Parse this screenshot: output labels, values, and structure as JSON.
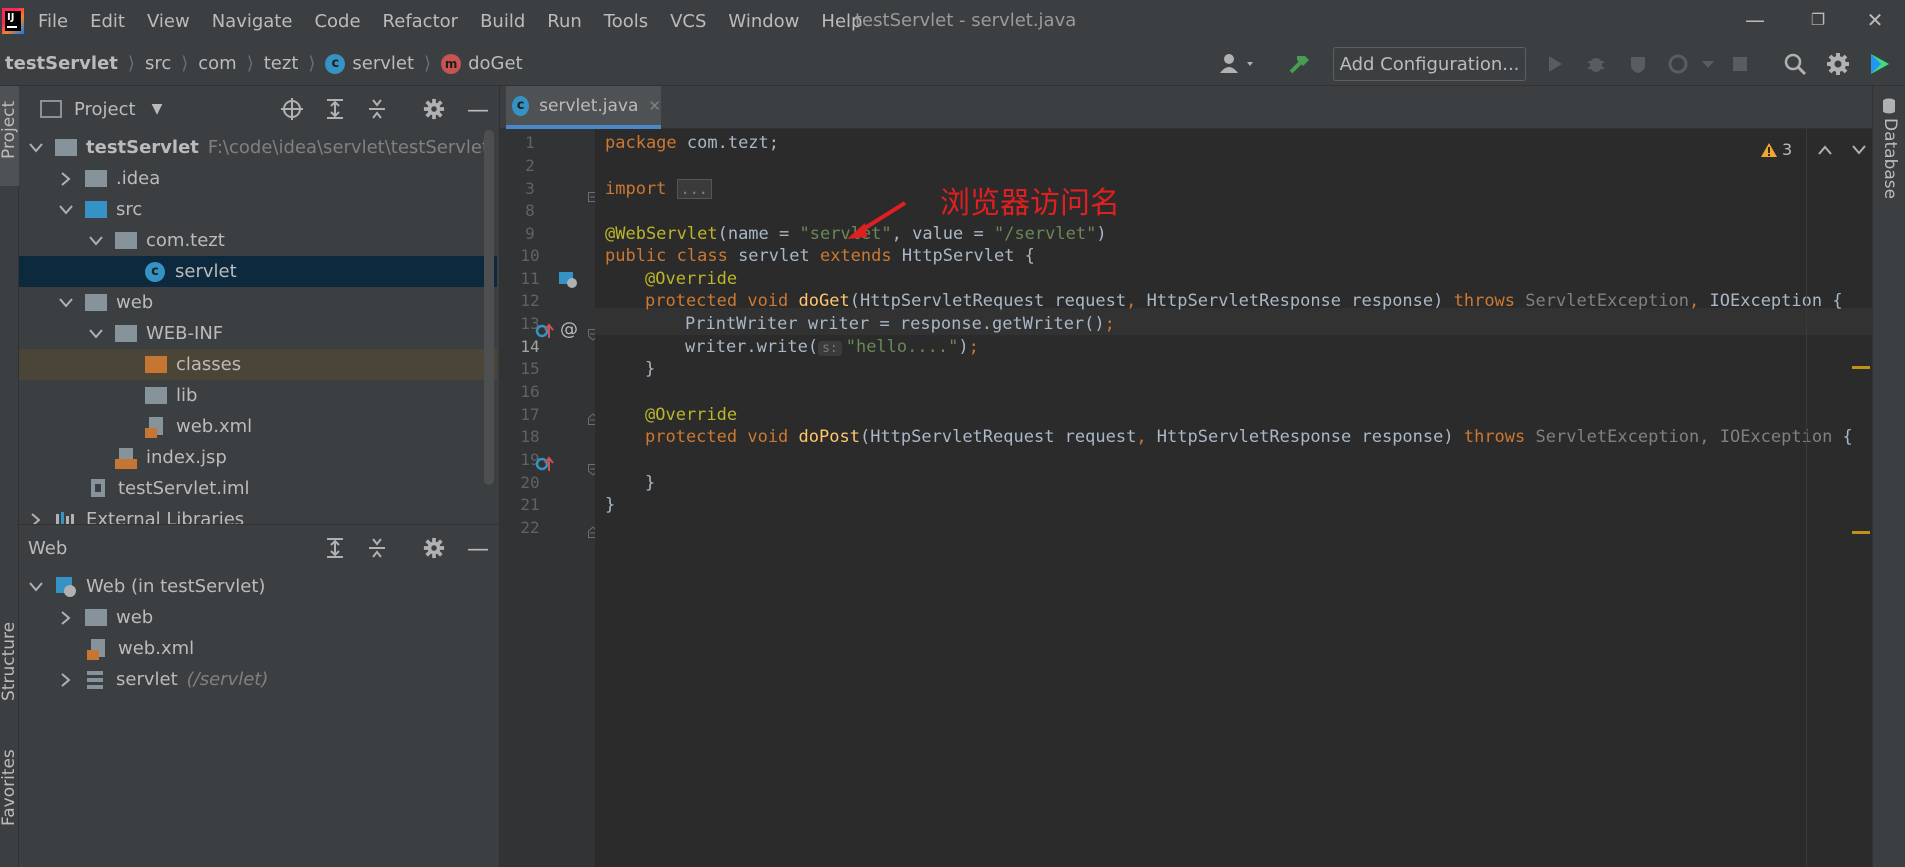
{
  "app": {
    "window_title": "testServlet - servlet.java",
    "menu": [
      "File",
      "Edit",
      "View",
      "Navigate",
      "Code",
      "Refactor",
      "Build",
      "Run",
      "Tools",
      "VCS",
      "Window",
      "Help"
    ],
    "menu_mnemonic": [
      "F",
      "E",
      "V",
      "N",
      "C",
      "R",
      "B",
      "R",
      "T",
      "",
      "W",
      "H"
    ]
  },
  "breadcrumb": {
    "items": [
      "testServlet",
      "src",
      "com",
      "tezt",
      "servlet",
      "doGet"
    ]
  },
  "toolbar": {
    "add_configuration": "Add Configuration..."
  },
  "side_strips": {
    "left_top": "Project",
    "left_mid": "Structure",
    "left_bottom": "Favorites",
    "right_top": "Database"
  },
  "project_panel": {
    "title": "Project",
    "rows": [
      {
        "label": "testServlet",
        "path": "F:\\code\\idea\\servlet\\testServlet"
      },
      {
        "label": ".idea"
      },
      {
        "label": "src"
      },
      {
        "label": "com.tezt"
      },
      {
        "label": "servlet"
      },
      {
        "label": "web"
      },
      {
        "label": "WEB-INF"
      },
      {
        "label": "classes"
      },
      {
        "label": "lib"
      },
      {
        "label": "web.xml"
      },
      {
        "label": "index.jsp"
      },
      {
        "label": "testServlet.iml"
      },
      {
        "label": "External Libraries"
      }
    ]
  },
  "web_panel": {
    "title": "Web",
    "rows": [
      {
        "label": "Web (in testServlet)"
      },
      {
        "label": "web"
      },
      {
        "label": "web.xml"
      },
      {
        "label": "servlet",
        "hint": "(/servlet)"
      }
    ]
  },
  "editor": {
    "tab_label": "servlet.java",
    "warning_count": "3",
    "annotation_text": "浏览器访问名",
    "line_numbers": [
      "1",
      "2",
      "3",
      "8",
      "9",
      "10",
      "11",
      "12",
      "13",
      "14",
      "15",
      "16",
      "17",
      "18",
      "19",
      "20",
      "21",
      "22"
    ],
    "code": {
      "l1_kw": "package",
      "l1_rest": " com.tezt;",
      "l3_kw": "import",
      "l3_fold": "...",
      "l9_ann": "@WebServlet",
      "l9_a": "(name = ",
      "l9_s1": "\"servlet\"",
      "l9_b": ", value = ",
      "l9_s2": "\"/servlet\"",
      "l9_c": ")",
      "l10_kw1": "public class",
      "l10_name": " servlet ",
      "l10_kw2": "extends",
      "l10_rest": " HttpServlet {",
      "l11": "@Override",
      "l12_kw": "protected void",
      "l12_fn": "doGet",
      "l12_a": "(HttpServletRequest request",
      "l12_comma": ",",
      "l12_b": " HttpServletResponse response) ",
      "l12_throws": "throws",
      "l12_ex1": " ServletException",
      "l12_comma2": ",",
      "l12_ex2": " IOException {",
      "l13": "PrintWriter writer = response.getWriter()",
      "l13_semi": ";",
      "l14_a": "writer.write(",
      "l14_hint": "s:",
      "l14_str": "\"hello....\"",
      "l14_b": ")",
      "l14_semi": ";",
      "l15": "}",
      "l17": "@Override",
      "l18_kw": "protected void",
      "l18_fn": "doPost",
      "l18_a": "(HttpServletRequest request",
      "l18_comma": ",",
      "l18_b": " HttpServletResponse response) ",
      "l18_throws": "throws",
      "l18_ex": " ServletException, IOException",
      "l18_end": " {",
      "l20": "}",
      "l21": "}"
    }
  },
  "colors": {
    "background": "#2b2b2b",
    "panel": "#3c3f41",
    "keyword": "#cc7832",
    "string": "#6a8759",
    "annotation": "#bbb529",
    "function": "#ffc66d",
    "selection": "#0d293e",
    "red_annotation": "#e02020"
  }
}
